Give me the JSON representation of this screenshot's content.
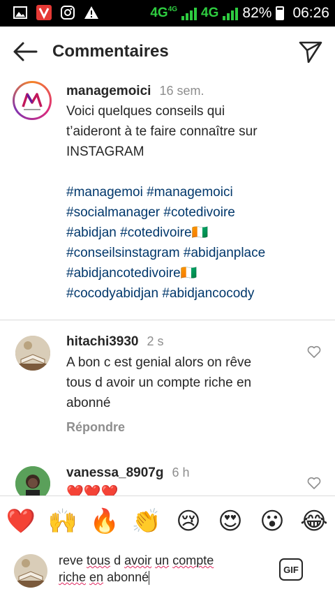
{
  "status_bar": {
    "net1": "4G",
    "net1_sup": "4G",
    "net2": "4G",
    "battery": "82%",
    "clock": "06:26",
    "icons": [
      "gallery-icon",
      "v-app-icon",
      "instagram-icon",
      "warning-icon"
    ]
  },
  "header": {
    "title": "Commentaires"
  },
  "caption": {
    "username": "managemoici",
    "time": "16 sem.",
    "text_lines": [
      "Voici quelques conseils qui",
      "t’aideront à te faire connaître sur",
      "INSTAGRAM"
    ],
    "hashtag_lines": [
      "#managemoi #managemoici",
      "#socialmanager #cotedivoire",
      "#abidjan #cotedivoire🇨🇮",
      "#conseilsinstagram #abidjanplace",
      "#abidjancotedivoire🇨🇮",
      "#cocodyabidjan #abidjancocody"
    ]
  },
  "comments": [
    {
      "username": "hitachi3930",
      "time": "2 s",
      "lines": [
        "A bon c est genial alors on rêve",
        "tous d avoir un compte riche en",
        "abonné"
      ],
      "reply_label": "Répondre"
    },
    {
      "username": "vanessa_8907g",
      "time": "6 h",
      "text": "❤️❤️❤️"
    }
  ],
  "emoji_bar": [
    "❤️",
    "🙌",
    "🔥",
    "👏",
    "😢",
    "😍",
    "😮",
    "😂"
  ],
  "composer": {
    "line1_words": [
      "reve",
      "tous",
      "d",
      "avoir",
      "un",
      "compte"
    ],
    "line2_words": [
      "riche",
      "en",
      "abonné"
    ],
    "gif_label": "GIF"
  },
  "colors": {
    "hashtag": "#00376b",
    "muted": "#8e8e8e",
    "signal": "#2ecc40"
  }
}
